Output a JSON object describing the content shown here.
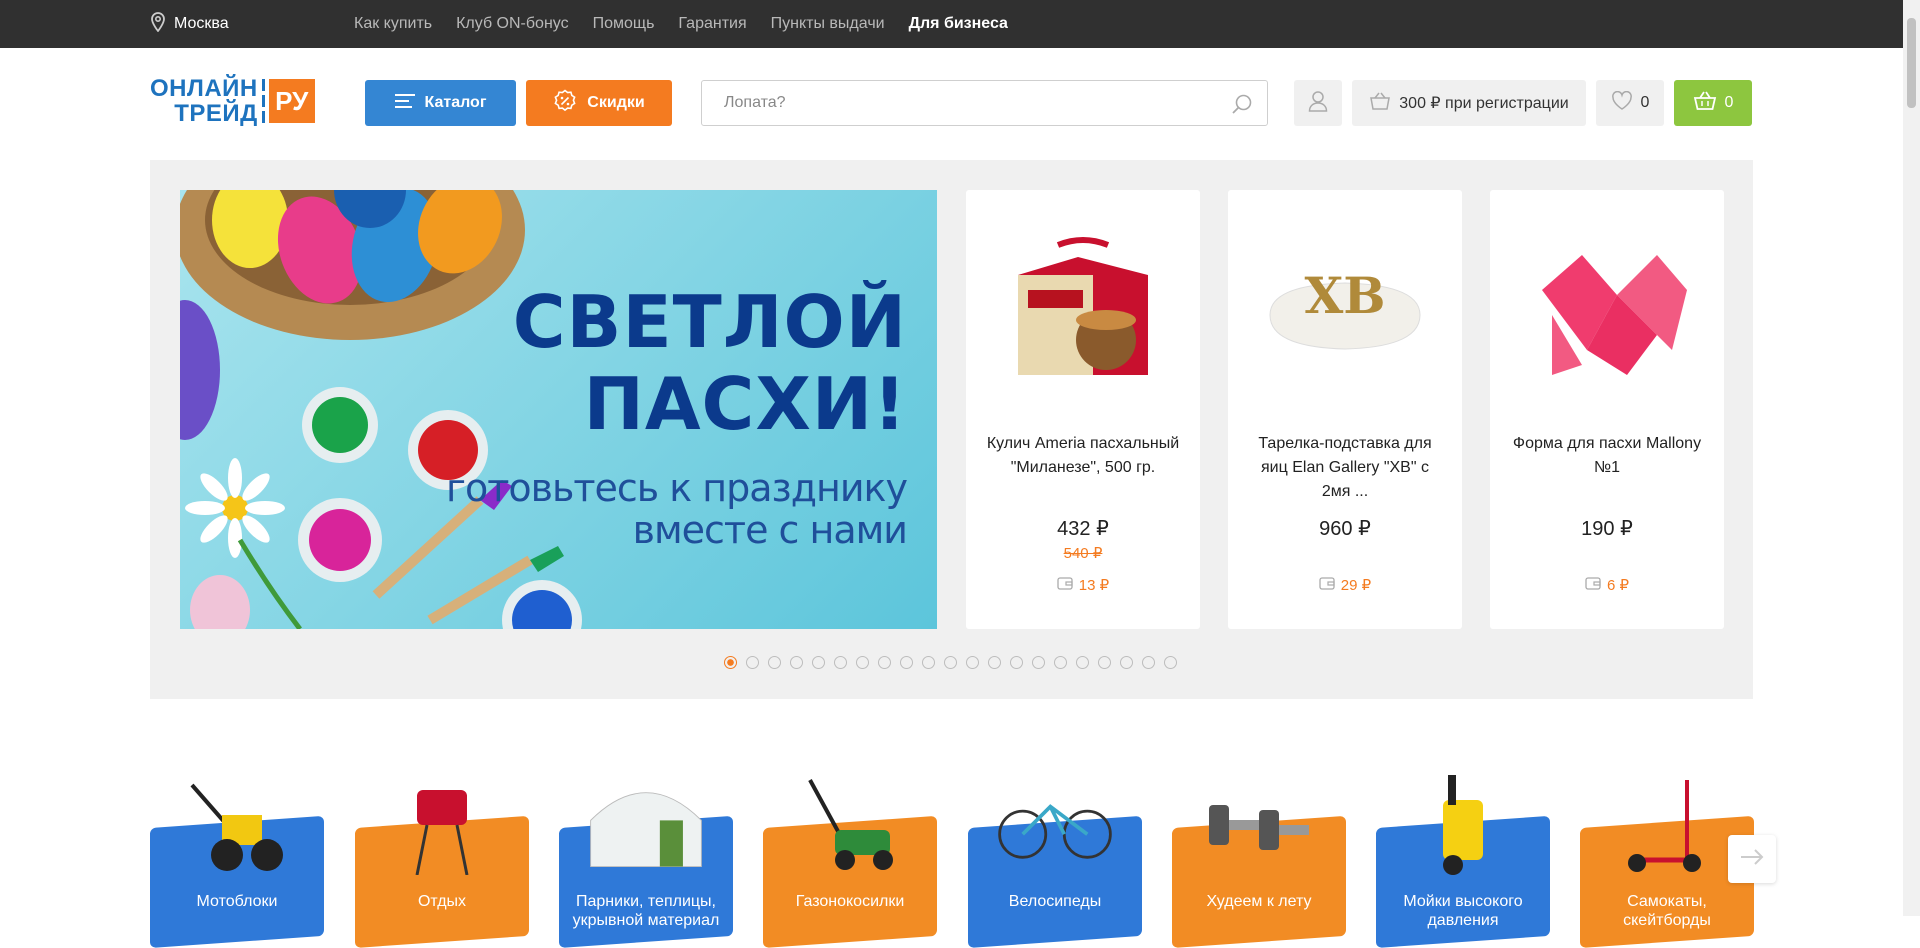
{
  "topbar": {
    "city": "Москва",
    "links": [
      "Как купить",
      "Клуб ON-бонус",
      "Помощь",
      "Гарантия",
      "Пункты выдачи"
    ],
    "business": "Для бизнеса"
  },
  "header": {
    "logo_line1": "ОНЛАЙН",
    "logo_line2": "ТРЕЙД",
    "logo_ru": "РУ",
    "catalog_label": "Каталог",
    "sales_label": "Скидки",
    "search_placeholder": "Лопата?",
    "bonus_label": "300 ₽ при регистрации",
    "favorites_count": "0",
    "cart_count": "0"
  },
  "banner": {
    "line1": "СВЕТЛОЙ",
    "line2": "ПАСХИ!",
    "line3": "готовьтесь к празднику",
    "line4": "вместе с нами"
  },
  "products": [
    {
      "name": "Кулич Ameria пасхальный \"Миланезе\", 500 гр.",
      "price": "432 ₽",
      "old_price": "540 ₽",
      "bonus": "13 ₽"
    },
    {
      "name": "Тарелка-подставка для яиц Elan Gallery \"ХВ\" с 2мя ...",
      "price": "960 ₽",
      "old_price": "",
      "bonus": "29 ₽"
    },
    {
      "name": "Форма для пасхи Mallony №1",
      "price": "190 ₽",
      "old_price": "",
      "bonus": "6 ₽"
    }
  ],
  "slider": {
    "total": 21,
    "active": 1
  },
  "categories": [
    {
      "label": "Мотоблоки",
      "color": "blue"
    },
    {
      "label": "Отдых",
      "color": "orange"
    },
    {
      "label": "Парники, теплицы, укрывной материал",
      "color": "blue"
    },
    {
      "label": "Газонокосилки",
      "color": "orange"
    },
    {
      "label": "Велосипеды",
      "color": "blue"
    },
    {
      "label": "Худеем к лету",
      "color": "orange"
    },
    {
      "label": "Мойки высокого давления",
      "color": "blue"
    },
    {
      "label": "Самокаты, скейтборды",
      "color": "orange"
    }
  ],
  "colors": {
    "brand_blue": "#1e73be",
    "accent_orange": "#f47b20",
    "cart_green": "#8dc63f",
    "topbar": "#303030"
  }
}
